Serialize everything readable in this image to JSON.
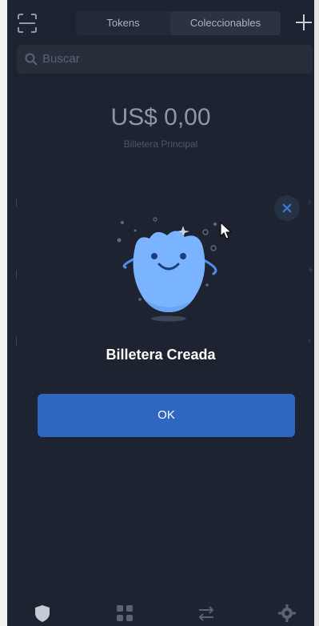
{
  "header": {
    "tabs": [
      "Tokens",
      "Coleccionables"
    ],
    "active_tab": "Coleccionables",
    "scan_icon": "scan-icon",
    "add_icon": "plus-icon"
  },
  "search": {
    "placeholder": "Buscar",
    "icon": "search-icon"
  },
  "wallet": {
    "balance": "US$ 0,00",
    "name": "Billetera Principal"
  },
  "modal": {
    "title": "Billetera Creada",
    "ok_label": "OK",
    "close_icon": "close-icon"
  },
  "bottom_nav": {
    "items": [
      "wallet-shield-icon",
      "apps-grid-icon",
      "swap-icon",
      "settings-gear-icon"
    ]
  },
  "colors": {
    "background": "#1d2330",
    "accent_button": "#2f66c1",
    "title_text": "#ffffff",
    "muted_text": "#8e97a8"
  }
}
